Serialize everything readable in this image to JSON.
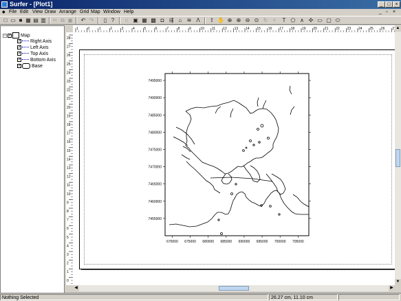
{
  "window": {
    "title": "Surfer - [Plot1]",
    "minimize": "_",
    "maximize": "□",
    "close": "×"
  },
  "menu": [
    "File",
    "Edit",
    "View",
    "Draw",
    "Arrange",
    "Grid",
    "Map",
    "Window",
    "Help"
  ],
  "tree": {
    "root": "Map",
    "children": [
      "Right Axis",
      "Left Axis",
      "Top Axis",
      "Bottom Axis",
      "Base"
    ]
  },
  "ruler": {
    "h_labels": [
      "1",
      "0",
      "1",
      "2",
      "3",
      "4",
      "5",
      "6",
      "7",
      "8",
      "9",
      "10",
      "11",
      "12",
      "13",
      "14",
      "15",
      "16",
      "17",
      "18",
      "19",
      "20",
      "21",
      "22",
      "23",
      "24",
      "25",
      "26",
      "27",
      "28"
    ],
    "v_labels": [
      "28",
      "27",
      "26",
      "25",
      "24",
      "23",
      "22",
      "21",
      "20",
      "19",
      "18",
      "17",
      "16",
      "15",
      "14",
      "13",
      "12",
      "11",
      "10",
      "9",
      "8",
      "7",
      "6",
      "5",
      "4",
      "3",
      "2",
      "1",
      "0"
    ]
  },
  "chart_data": {
    "type": "map",
    "xlabel_ticks": [
      "670000",
      "675000",
      "680000",
      "685000",
      "690000",
      "695000",
      "700000",
      "705000"
    ],
    "ylabel_ticks": [
      "7495000",
      "7490000",
      "7485000",
      "7480000",
      "7475000",
      "7470000",
      "7465000",
      "7460000",
      "7455000"
    ],
    "xlim": [
      668000,
      708000
    ],
    "ylim": [
      7450000,
      7497000
    ]
  },
  "status": {
    "left": "Nothing Selected",
    "right": "26.27 cm, 11.10 cm"
  }
}
